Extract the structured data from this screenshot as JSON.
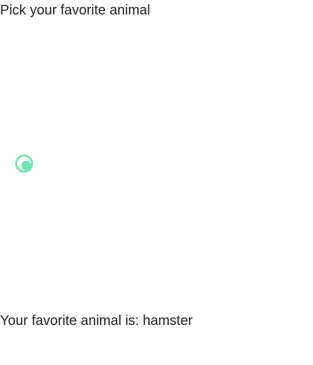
{
  "question": {
    "text": "Pick your favorite animal"
  },
  "radio_group": {
    "selected_value": "hamster",
    "accent_color": "#6ee7b0",
    "options": [
      {
        "label": "",
        "checked": true
      }
    ]
  },
  "result": {
    "prefix": "Your favorite animal is: ",
    "value": "hamster"
  }
}
